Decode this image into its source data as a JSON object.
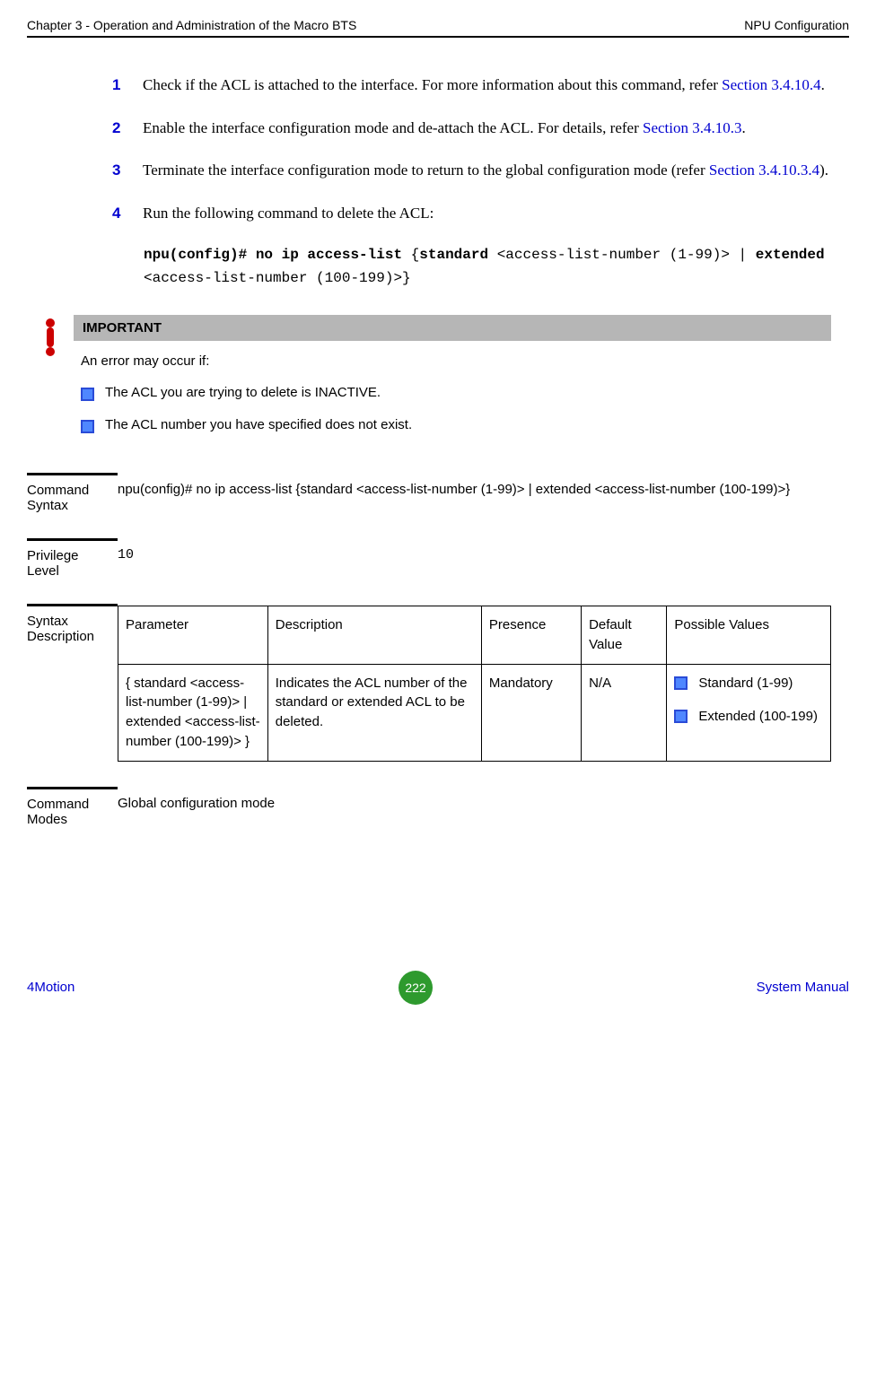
{
  "header": {
    "left": "Chapter 3 - Operation and Administration of the Macro BTS",
    "right": "NPU Configuration"
  },
  "steps": [
    {
      "num": "1",
      "pre": "Check if the ACL is attached to the interface. For more information about this command, refer ",
      "link": "Section 3.4.10.4",
      "post": "."
    },
    {
      "num": "2",
      "pre": "Enable the interface configuration mode and de-attach the ACL. For details, refer ",
      "link": "Section 3.4.10.3",
      "post": "."
    },
    {
      "num": "3",
      "pre": "Terminate the interface configuration mode to return to the global configuration mode (refer ",
      "link": "Section 3.4.10.3.4",
      "post": ")."
    },
    {
      "num": "4",
      "pre": "Run the following command to delete the ACL:",
      "link": "",
      "post": ""
    }
  ],
  "command": {
    "b1": "npu(config)# no ip access-list ",
    "p1": "{",
    "b2": "standard ",
    "p2": "<access-list-number (1-99)> | ",
    "b3": "extended ",
    "p3": "<access-list-number (100-199)>}"
  },
  "important": {
    "title": "IMPORTANT",
    "lead": "An error may occur if:",
    "items": [
      "The ACL you are trying to delete is INACTIVE.",
      "The ACL number you have specified does not exist."
    ]
  },
  "cmd_syntax": {
    "label": "Command Syntax",
    "value": "npu(config)# no ip access-list {standard <access-list-number (1-99)> | extended <access-list-number (100-199)>}"
  },
  "priv": {
    "label": "Privilege Level",
    "value": "10"
  },
  "syntax_desc": {
    "label": "Syntax Description",
    "headers": [
      "Parameter",
      "Description",
      "Presence",
      "Default Value",
      "Possible Values"
    ],
    "row": {
      "param": "{ standard <access-list-number (1-99)> | extended <access-list-number (100-199)> }",
      "desc": "Indicates the ACL number of the standard or extended ACL to be deleted.",
      "presence": "Mandatory",
      "default": "N/A",
      "possible": [
        "Standard (1-99)",
        "Extended (100-199)"
      ]
    }
  },
  "cmd_modes": {
    "label": "Command Modes",
    "value": "Global configuration mode"
  },
  "footer": {
    "left": "4Motion",
    "page": "222",
    "right": "System Manual"
  }
}
